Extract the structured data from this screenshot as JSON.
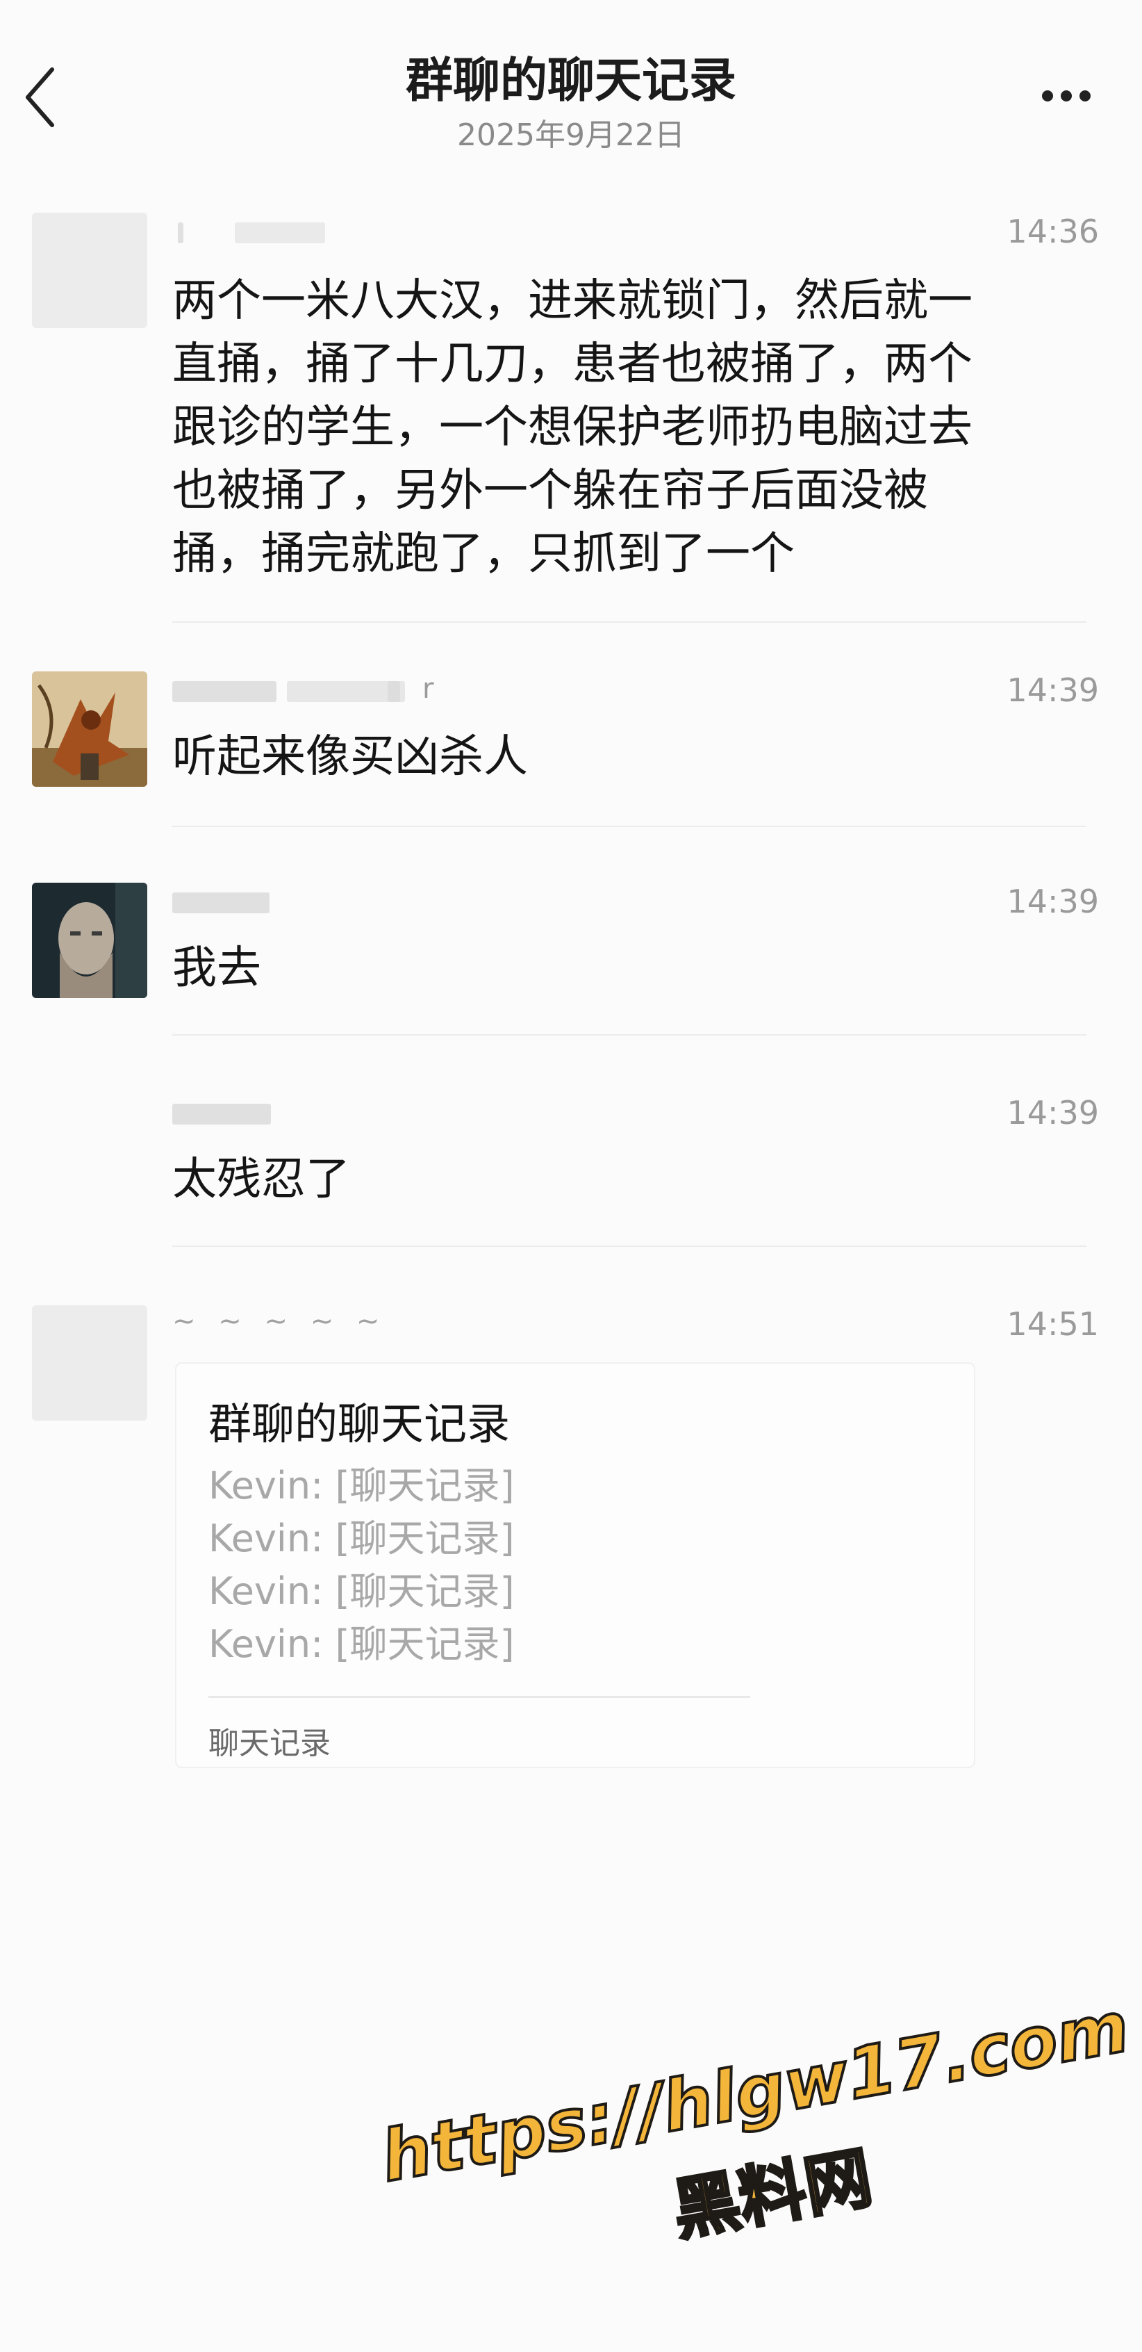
{
  "header": {
    "title": "群聊的聊天记录",
    "subtitle": "2025年9月22日",
    "back_icon": "chevron-left-icon",
    "more_icon": "more-horizontal-icon"
  },
  "messages": [
    {
      "time": "14:36",
      "text_lines": [
        "两个一米八大汉，进来就锁门，然后就一",
        "直捅，捅了十几刀，患者也被捅了，两个",
        "跟诊的学生，一个想保护老师扔电脑过去",
        "也被捅了，另外一个躲在帘子后面没被",
        "捅，捅完就跑了，只抓到了一个"
      ]
    },
    {
      "time": "14:39",
      "sender_visible": "r",
      "text": "听起来像买凶杀人"
    },
    {
      "time": "14:39",
      "text": "我去"
    },
    {
      "time": "14:39",
      "text": "太残忍了"
    },
    {
      "time": "14:51",
      "sender_visible": "~ ~ ~ ~ ~",
      "card": {
        "title": "群聊的聊天记录",
        "lines": [
          "Kevin: [聊天记录]",
          "Kevin: [聊天记录]",
          "Kevin: [聊天记录]",
          "Kevin: [聊天记录]"
        ],
        "footer": "聊天记录"
      }
    }
  ],
  "watermark": {
    "url": "https://hlgw17.com",
    "site": "黑料网"
  },
  "colors": {
    "background": "#fbfbfb",
    "watermark": "#f3b63a"
  }
}
